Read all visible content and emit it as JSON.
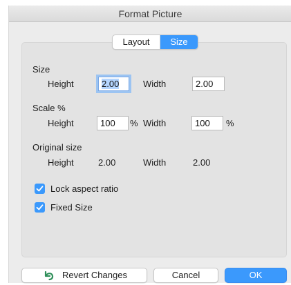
{
  "window": {
    "title": "Format Picture"
  },
  "tabs": [
    {
      "label": "Layout",
      "selected": false
    },
    {
      "label": "Size",
      "selected": true
    }
  ],
  "size_section": {
    "title": "Size",
    "height_label": "Height",
    "height_value": "2.00",
    "width_label": "Width",
    "width_value": "2.00"
  },
  "scale_section": {
    "title": "Scale %",
    "height_label": "Height",
    "height_value": "100",
    "height_unit": "%",
    "width_label": "Width",
    "width_value": "100",
    "width_unit": "%"
  },
  "original_section": {
    "title": "Original size",
    "height_label": "Height",
    "height_value": "2.00",
    "width_label": "Width",
    "width_value": "2.00"
  },
  "options": {
    "lock_aspect": {
      "label": "Lock aspect ratio",
      "checked": true
    },
    "fixed_size": {
      "label": "Fixed Size",
      "checked": true
    }
  },
  "buttons": {
    "revert": "Revert Changes",
    "cancel": "Cancel",
    "ok": "OK"
  },
  "colors": {
    "accent": "#3b99fc",
    "revert_icon": "#2f8f5a"
  }
}
